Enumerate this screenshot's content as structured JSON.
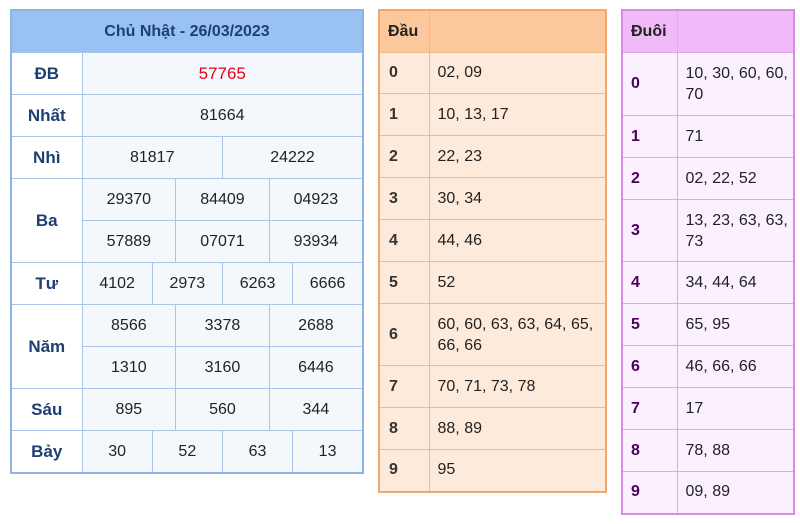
{
  "results": {
    "title": "Chủ Nhật - 26/03/2023",
    "db": {
      "label": "ĐB",
      "values": [
        "57765"
      ]
    },
    "nhat": {
      "label": "Nhất",
      "values": [
        "81664"
      ]
    },
    "nhi": {
      "label": "Nhì",
      "values": [
        "81817",
        "24222"
      ]
    },
    "ba": {
      "label": "Ba",
      "values": [
        "29370",
        "84409",
        "04923",
        "57889",
        "07071",
        "93934"
      ]
    },
    "tu": {
      "label": "Tư",
      "values": [
        "4102",
        "2973",
        "6263",
        "6666"
      ]
    },
    "nam": {
      "label": "Năm",
      "values": [
        "8566",
        "3378",
        "2688",
        "1310",
        "3160",
        "6446"
      ]
    },
    "sau": {
      "label": "Sáu",
      "values": [
        "895",
        "560",
        "344"
      ]
    },
    "bay": {
      "label": "Bảy",
      "values": [
        "30",
        "52",
        "63",
        "13"
      ]
    }
  },
  "dau": {
    "header": "Đầu",
    "rows": [
      {
        "key": "0",
        "value": "02, 09"
      },
      {
        "key": "1",
        "value": "10, 13, 17"
      },
      {
        "key": "2",
        "value": "22, 23"
      },
      {
        "key": "3",
        "value": "30, 34"
      },
      {
        "key": "4",
        "value": "44, 46"
      },
      {
        "key": "5",
        "value": "52"
      },
      {
        "key": "6",
        "value": "60, 60, 63, 63, 64, 65, 66, 66"
      },
      {
        "key": "7",
        "value": "70, 71, 73, 78"
      },
      {
        "key": "8",
        "value": "88, 89"
      },
      {
        "key": "9",
        "value": "95"
      }
    ]
  },
  "duoi": {
    "header": "Đuôi",
    "rows": [
      {
        "key": "0",
        "value": "10, 30, 60, 60, 70"
      },
      {
        "key": "1",
        "value": "71"
      },
      {
        "key": "2",
        "value": "02, 22, 52"
      },
      {
        "key": "3",
        "value": "13, 23, 63, 63, 73"
      },
      {
        "key": "4",
        "value": "34, 44, 64"
      },
      {
        "key": "5",
        "value": "65, 95"
      },
      {
        "key": "6",
        "value": "46, 66, 66"
      },
      {
        "key": "7",
        "value": "17"
      },
      {
        "key": "8",
        "value": "78, 88"
      },
      {
        "key": "9",
        "value": "09, 89"
      }
    ]
  },
  "colors": {
    "result_header": "#99c2f2",
    "special_prize": "#e3001b",
    "dau_header": "#fbc89c",
    "duoi_header": "#f0b9f7"
  }
}
